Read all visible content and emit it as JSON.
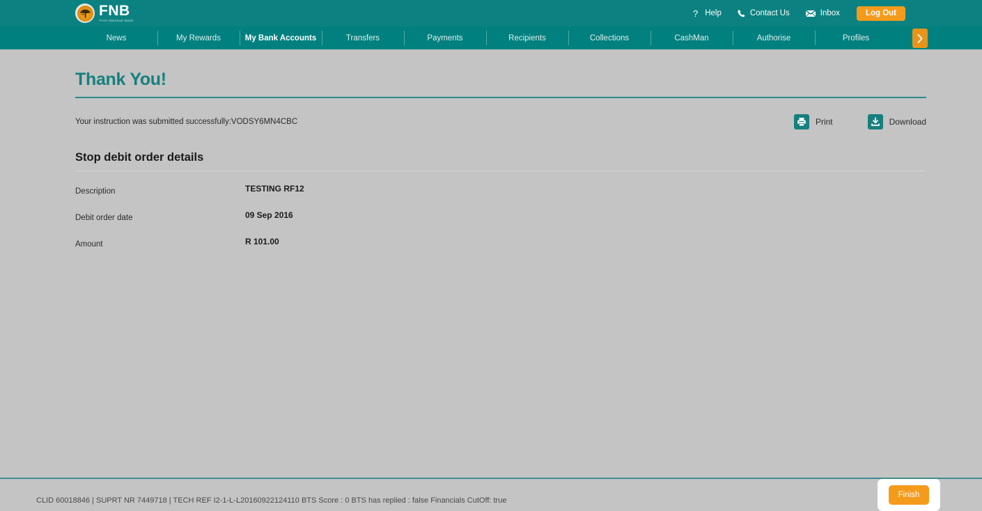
{
  "header": {
    "logo": {
      "name": "FNB",
      "tagline": "First National Bank",
      "emblem_icon": "acacia-tree-icon"
    },
    "links": [
      {
        "label": "Help",
        "icon": "question-mark-icon"
      },
      {
        "label": "Contact Us",
        "icon": "phone-icon"
      },
      {
        "label": "Inbox",
        "icon": "envelope-icon"
      }
    ],
    "logout_label": "Log Out"
  },
  "nav": {
    "items": [
      {
        "label": "News",
        "active": false
      },
      {
        "label": "My Rewards",
        "active": false
      },
      {
        "label": "My Bank Accounts",
        "active": true
      },
      {
        "label": "Transfers",
        "active": false
      },
      {
        "label": "Payments",
        "active": false
      },
      {
        "label": "Recipients",
        "active": false
      },
      {
        "label": "Collections",
        "active": false
      },
      {
        "label": "CashMan",
        "active": false
      },
      {
        "label": "Authorise",
        "active": false
      },
      {
        "label": "Profiles",
        "active": false
      }
    ],
    "more_icon": "chevron-right-icon"
  },
  "main": {
    "page_title": "Thank You!",
    "confirmation_message": "Your instruction was submitted successfully:VODSY6MN4CBC",
    "actions": [
      {
        "label": "Print",
        "icon": "printer-icon"
      },
      {
        "label": "Download",
        "icon": "download-icon"
      }
    ],
    "section_title": "Stop debit order details",
    "details": [
      {
        "label": "Description",
        "value": "TESTING RF12"
      },
      {
        "label": "Debit order date",
        "value": "09 Sep 2016"
      },
      {
        "label": "Amount",
        "value": "R 101.00"
      }
    ]
  },
  "footer": {
    "status_text": "CLID 60018846 | SUPRT NR 7449718 | TECH REF I2-1-L-L20160922124110 BTS Score : 0 BTS has replied : false Financials CutOff: true",
    "finish_label": "Finish"
  },
  "colors": {
    "header_teal": "#0b8281",
    "nav_teal": "#00807f",
    "accent_orange": "#f59b1c",
    "page_background": "#c4c4c4",
    "title_teal": "#16807f"
  }
}
